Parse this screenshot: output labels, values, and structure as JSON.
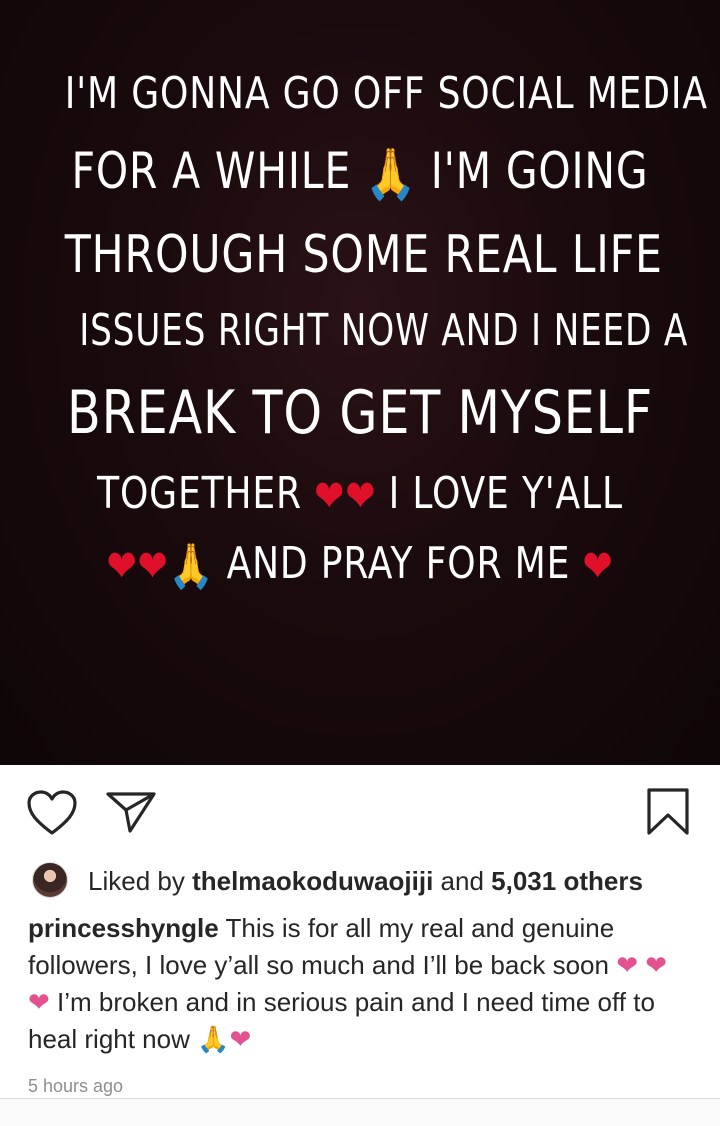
{
  "story": {
    "lines": [
      {
        "text": "I'M GONNA GO OFF SOCIAL MEDIA"
      },
      {
        "pre": "FOR A WHILE ",
        "emoji": "🙏",
        "post": " I'M GOING"
      },
      {
        "text": "THROUGH SOME REAL LIFE"
      },
      {
        "text": "ISSUES RIGHT NOW AND I NEED A"
      },
      {
        "text": "BREAK TO GET MYSELF"
      },
      {
        "pre": "TOGETHER ",
        "emoji": "❤❤",
        "post": " I LOVE Y'ALL"
      },
      {
        "emoji_a": "❤❤",
        "emoji_b": "🙏",
        "mid": " AND PRAY FOR ME ",
        "emoji_c": "❤"
      }
    ]
  },
  "actions": {
    "like_icon": "heart-outline-icon",
    "share_icon": "paper-plane-icon",
    "save_icon": "bookmark-icon"
  },
  "likes": {
    "prefix": "Liked by ",
    "user": "thelmaokoduwaojiji",
    "and": " and ",
    "count": "5,031 others"
  },
  "caption": {
    "username": "princesshyngle",
    "text1": " This is for all my real and genuine followers, I love y’all so much and I’ll be back soon ",
    "hearts": "❤ ❤ ❤",
    "text2": "  I’m broken and in serious pain and I need time off to heal right now ",
    "pray": "🙏",
    "end_heart": "❤"
  },
  "timestamp": "5 hours ago",
  "colors": {
    "story_bg": "#1a0a0d",
    "heart_red": "#e0102a",
    "caption_pink": "#e3528f"
  }
}
